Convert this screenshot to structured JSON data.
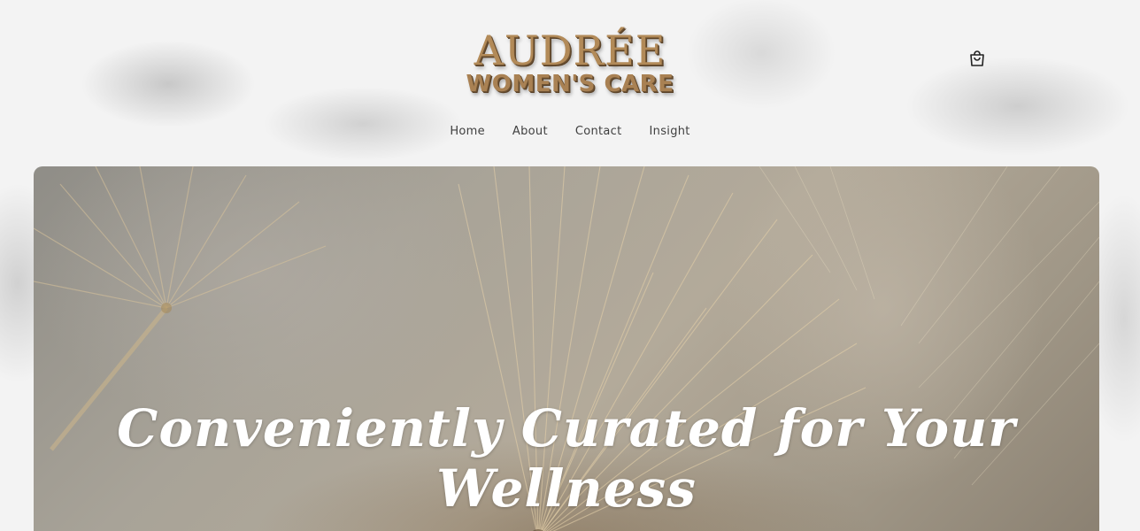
{
  "brand": {
    "name_line1": "AUDRÉE",
    "name_line2": "WOMEN'S CARE",
    "primary_color": "#b28a58"
  },
  "header": {
    "cart_icon": "shopping-bag-icon"
  },
  "nav": {
    "items": [
      {
        "label": "Home"
      },
      {
        "label": "About"
      },
      {
        "label": "Contact"
      },
      {
        "label": "Insight"
      }
    ]
  },
  "hero": {
    "title": "Conveniently Curated for Your Wellness",
    "background": "dandelion-seed-image"
  }
}
